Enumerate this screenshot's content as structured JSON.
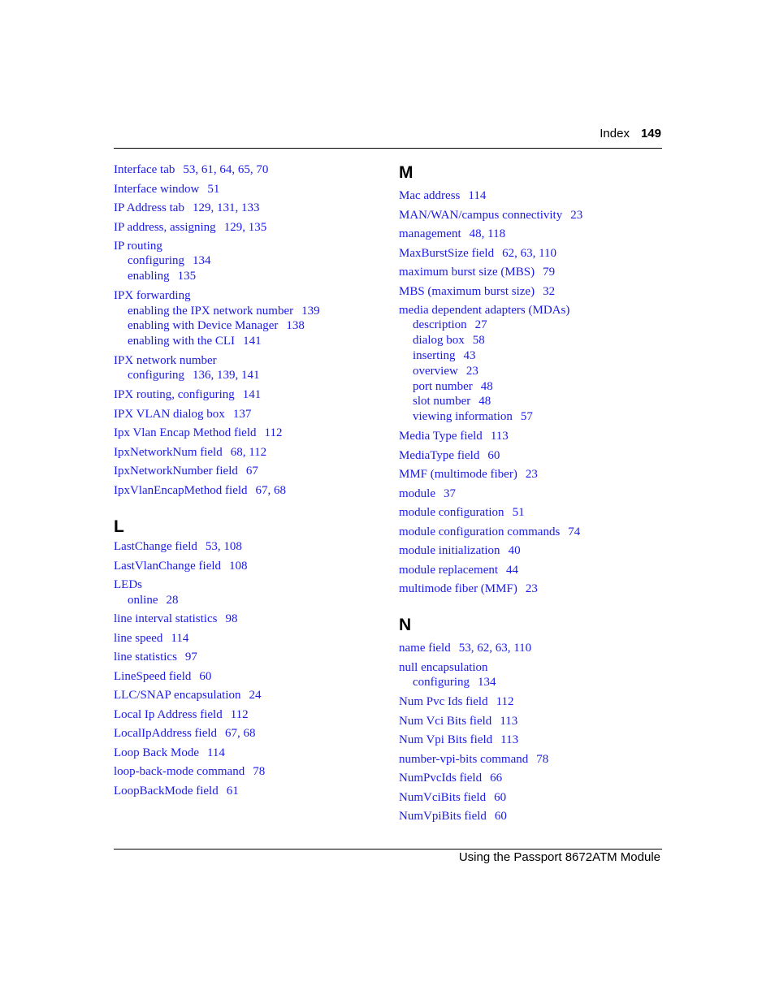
{
  "header": {
    "section": "Index",
    "page_number": "149"
  },
  "footer": {
    "title": "Using the Passport 8672ATM Module"
  },
  "left_column": {
    "continued_entries": [
      {
        "term": "Interface tab",
        "pages": "53, 61, 64, 65, 70",
        "subentries": []
      },
      {
        "term": "Interface window",
        "pages": "51",
        "subentries": []
      },
      {
        "term": "IP Address tab",
        "pages": "129, 131, 133",
        "subentries": []
      },
      {
        "term": "IP address, assigning",
        "pages": "129, 135",
        "subentries": []
      },
      {
        "term": "IP routing",
        "pages": "",
        "subentries": [
          {
            "term": "configuring",
            "pages": "134"
          },
          {
            "term": "enabling",
            "pages": "135"
          }
        ]
      },
      {
        "term": "IPX forwarding",
        "pages": "",
        "subentries": [
          {
            "term": "enabling the IPX network number",
            "pages": "139"
          },
          {
            "term": "enabling with Device Manager",
            "pages": "138"
          },
          {
            "term": "enabling with the CLI",
            "pages": "141"
          }
        ]
      },
      {
        "term": "IPX network number",
        "pages": "",
        "subentries": [
          {
            "term": "configuring",
            "pages": "136, 139, 141"
          }
        ]
      },
      {
        "term": "IPX routing, configuring",
        "pages": "141",
        "subentries": []
      },
      {
        "term": "IPX VLAN dialog box",
        "pages": "137",
        "subentries": []
      },
      {
        "term": "Ipx Vlan Encap Method field",
        "pages": "112",
        "subentries": []
      },
      {
        "term": "IpxNetworkNum field",
        "pages": "68, 112",
        "subentries": []
      },
      {
        "term": "IpxNetworkNumber field",
        "pages": "67",
        "subentries": []
      },
      {
        "term": "IpxVlanEncapMethod field",
        "pages": "67, 68",
        "subentries": []
      }
    ],
    "section_L": {
      "letter": "L",
      "entries": [
        {
          "term": "LastChange field",
          "pages": "53, 108",
          "subentries": []
        },
        {
          "term": "LastVlanChange field",
          "pages": "108",
          "subentries": []
        },
        {
          "term": "LEDs",
          "pages": "",
          "subentries": [
            {
              "term": "online",
              "pages": "28"
            }
          ]
        },
        {
          "term": "line interval statistics",
          "pages": "98",
          "subentries": []
        },
        {
          "term": "line speed",
          "pages": "114",
          "subentries": []
        },
        {
          "term": "line statistics",
          "pages": "97",
          "subentries": []
        },
        {
          "term": "LineSpeed field",
          "pages": "60",
          "subentries": []
        },
        {
          "term": "LLC/SNAP encapsulation",
          "pages": "24",
          "subentries": []
        },
        {
          "term": "Local Ip Address field",
          "pages": "112",
          "subentries": []
        },
        {
          "term": "LocalIpAddress field",
          "pages": "67, 68",
          "subentries": []
        },
        {
          "term": "Loop Back Mode",
          "pages": "114",
          "subentries": []
        },
        {
          "term": "loop-back-mode command",
          "pages": "78",
          "subentries": []
        },
        {
          "term": "LoopBackMode field",
          "pages": "61",
          "subentries": []
        }
      ]
    }
  },
  "right_column": {
    "section_M": {
      "letter": "M",
      "entries": [
        {
          "term": "Mac address",
          "pages": "114",
          "subentries": []
        },
        {
          "term": "MAN/WAN/campus connectivity",
          "pages": "23",
          "subentries": []
        },
        {
          "term": "management",
          "pages": "48, 118",
          "subentries": []
        },
        {
          "term": "MaxBurstSize field",
          "pages": "62, 63, 110",
          "subentries": []
        },
        {
          "term": "maximum burst size (MBS)",
          "pages": "79",
          "subentries": []
        },
        {
          "term": "MBS (maximum burst size)",
          "pages": "32",
          "subentries": []
        },
        {
          "term": "media dependent adapters (MDAs)",
          "pages": "",
          "subentries": [
            {
              "term": "description",
              "pages": "27"
            },
            {
              "term": "dialog box",
              "pages": "58"
            },
            {
              "term": "inserting",
              "pages": "43"
            },
            {
              "term": "overview",
              "pages": "23"
            },
            {
              "term": "port number",
              "pages": "48"
            },
            {
              "term": "slot number",
              "pages": "48"
            },
            {
              "term": "viewing information",
              "pages": "57"
            }
          ]
        },
        {
          "term": "Media Type field",
          "pages": "113",
          "subentries": []
        },
        {
          "term": "MediaType field",
          "pages": "60",
          "subentries": []
        },
        {
          "term": "MMF (multimode fiber)",
          "pages": "23",
          "subentries": []
        },
        {
          "term": "module",
          "pages": "37",
          "subentries": []
        },
        {
          "term": "module configuration",
          "pages": "51",
          "subentries": []
        },
        {
          "term": "module configuration commands",
          "pages": "74",
          "subentries": []
        },
        {
          "term": "module initialization",
          "pages": "40",
          "subentries": []
        },
        {
          "term": "module replacement",
          "pages": "44",
          "subentries": []
        },
        {
          "term": "multimode fiber (MMF)",
          "pages": "23",
          "subentries": []
        }
      ]
    },
    "section_N": {
      "letter": "N",
      "entries": [
        {
          "term": "name field",
          "pages": "53, 62, 63, 110",
          "subentries": []
        },
        {
          "term": "null encapsulation",
          "pages": "",
          "subentries": [
            {
              "term": "configuring",
              "pages": "134"
            }
          ]
        },
        {
          "term": "Num Pvc Ids field",
          "pages": "112",
          "subentries": []
        },
        {
          "term": "Num Vci Bits field",
          "pages": "113",
          "subentries": []
        },
        {
          "term": "Num Vpi Bits field",
          "pages": "113",
          "subentries": []
        },
        {
          "term": "number-vpi-bits command",
          "pages": "78",
          "subentries": []
        },
        {
          "term": "NumPvcIds field",
          "pages": "66",
          "subentries": []
        },
        {
          "term": "NumVciBits field",
          "pages": "60",
          "subentries": []
        },
        {
          "term": "NumVpiBits field",
          "pages": "60",
          "subentries": []
        }
      ]
    }
  }
}
